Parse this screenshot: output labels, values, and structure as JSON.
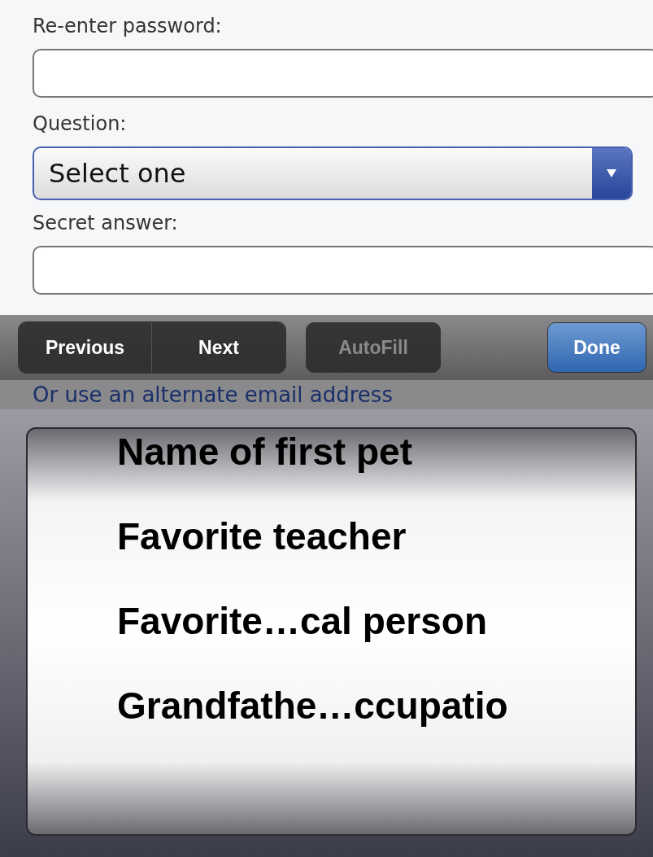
{
  "form": {
    "fields": [
      {
        "kind": "text",
        "label": "Re-enter password:"
      },
      {
        "kind": "select",
        "label": "Question:",
        "value": "Select one",
        "focused": true
      },
      {
        "kind": "text",
        "label": "Secret answer:"
      }
    ]
  },
  "toolbar": {
    "buttons": [
      {
        "label": "Previous",
        "kind": "segment",
        "disabled": false
      },
      {
        "label": "Next",
        "kind": "segment",
        "disabled": false
      },
      {
        "label": "AutoFill",
        "kind": "plain",
        "disabled": true
      },
      {
        "label": "Done",
        "kind": "primary",
        "disabled": false
      }
    ]
  },
  "link": "Or use an alternate email address",
  "picker": {
    "options": [
      "Name of first pet",
      "Favorite teacher",
      "Favorite…cal person",
      "Grandfathe…ccupatio"
    ]
  }
}
